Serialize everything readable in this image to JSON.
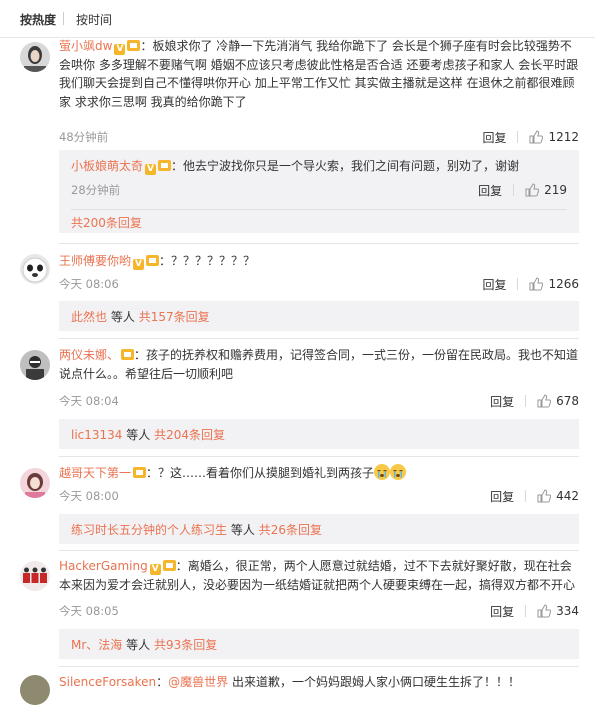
{
  "sort": {
    "hot": "按热度",
    "time": "按时间"
  },
  "colors": {
    "accent": "#eb7350",
    "subBg": "#f2f2f5"
  },
  "comments": [
    {
      "user": "萤小飒dw",
      "text": "板娘求你了 冷静一下先消消气 我给你跪下了 会长是个狮子座有时会比较强势不会哄你 多多理解不要赌气啊 婚姻不应该只考虑彼此性格是否合适 还要考虑孩子和家人 会长平时跟我们聊天会提到自己不懂得哄你开心 加上平常工作又忙 其实做主播就是这样 在退休之前都很难顾家 求求你三思啊 我真的给你跪下了",
      "time": "48分钟前",
      "reply": "回复",
      "likes": "1212",
      "sub": {
        "user": "小板娘萌太奇",
        "text": "他去宁波找你只是一个导火索，我们之间有问题，别劝了，谢谢",
        "time": "28分钟前",
        "reply": "回复",
        "likes": "219",
        "more": "共200条回复"
      }
    },
    {
      "user": "王师傅要你哟",
      "text": "？？？？？？？",
      "time": "今天 08:06",
      "reply": "回复",
      "likes": "1266",
      "sub": {
        "who": "此然也",
        "mid": "等人",
        "count": "共157条回复"
      }
    },
    {
      "user": "两仪未娜、",
      "text": "孩子的抚养权和赡养费用，记得签合同，一式三份，一份留在民政局。我也不知道说点什么。。希望往后一切顺利吧",
      "time": "今天 08:04",
      "reply": "回复",
      "likes": "678",
      "sub": {
        "who": "lic13134",
        "mid": "等人",
        "count": "共204条回复"
      }
    },
    {
      "user": "越哥天下第一",
      "text": "？这……看着你们从摸腿到婚礼到两孩子",
      "time": "今天 08:00",
      "reply": "回复",
      "likes": "442",
      "sub": {
        "who": "练习时长五分钟的个人练习生",
        "mid": "等人",
        "count": "共26条回复"
      }
    },
    {
      "user": "HackerGaming",
      "text": "离婚么，很正常，两个人愿意过就结婚，过不下去就好聚好散，现在社会本来因为爱才会迁就别人，没必要因为一纸结婚证就把两个人硬要束缚在一起，搞得双方都不开心",
      "time": "今天 08:05",
      "reply": "回复",
      "likes": "334",
      "sub": {
        "who": "Mr、法海",
        "mid": "等人",
        "count": "共93条回复"
      }
    },
    {
      "user": "SilenceForsaken",
      "mention": "@魔兽世界",
      "text": "出来道歉，一个妈妈跟姆人家小俩口硬生生拆了！！！"
    }
  ]
}
